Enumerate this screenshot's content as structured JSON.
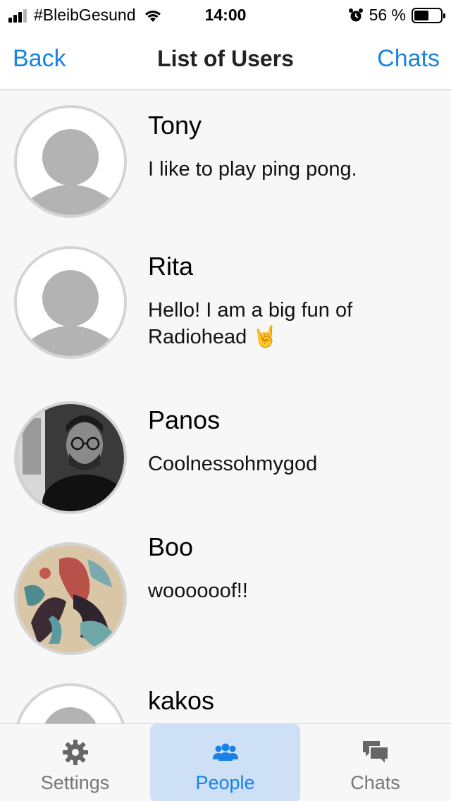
{
  "status_bar": {
    "carrier": "#BleibGesund",
    "time": "14:00",
    "battery_percent": "56 %",
    "battery_level": 0.56
  },
  "nav": {
    "back_label": "Back",
    "title": "List of Users",
    "right_label": "Chats"
  },
  "users": [
    {
      "name": "Tony",
      "bio": "I like to play ping pong.",
      "avatar": "default-avatar"
    },
    {
      "name": "Rita",
      "bio": "Hello! I am a big fun of Radiohead 🤘",
      "avatar": "default-avatar"
    },
    {
      "name": "Panos",
      "bio": "Coolnessohmygod",
      "avatar": "photo-avatar"
    },
    {
      "name": "Boo",
      "bio": "woooooof!!",
      "avatar": "painting-avatar"
    },
    {
      "name": "kakos",
      "bio": "",
      "avatar": "default-avatar"
    }
  ],
  "tabs": [
    {
      "label": "Settings",
      "icon": "gear-icon",
      "active": false
    },
    {
      "label": "People",
      "icon": "people-icon",
      "active": true
    },
    {
      "label": "Chats",
      "icon": "chat-bubbles-icon",
      "active": false
    }
  ],
  "colors": {
    "accent": "#1a82e6",
    "active_tab_bg": "#cde0f6",
    "avatar_placeholder": "#b3b3b3"
  }
}
